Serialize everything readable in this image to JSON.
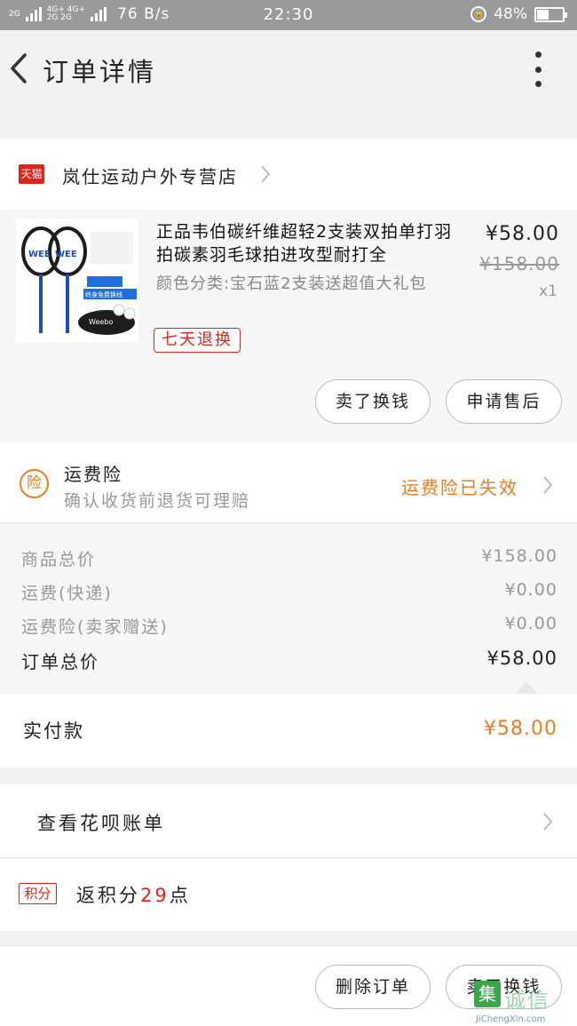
{
  "status_bar": {
    "network_left": "2G",
    "network_mid": "4G+ 4G+",
    "network_mid2": "2G 2G",
    "speed": "76 B/s",
    "time": "22:30",
    "battery": "48%",
    "battery_level": 0.48
  },
  "header": {
    "title": "订单详情"
  },
  "store": {
    "badge": "天猫",
    "name": "岚仕运动户外专营店"
  },
  "product": {
    "title": "正品韦伯碳纤维超轻2支装双拍单打羽拍碳素羽毛球拍进攻型耐打全",
    "spec": "颜色分类:宝石蓝2支装送超值大礼包",
    "badge": "七天退换",
    "price": "¥58.00",
    "original_price": "¥158.00",
    "quantity": "x1",
    "thumb_text": "终身免费换线",
    "thumb_brand": "Weebo",
    "btn_sell": "卖了换钱",
    "btn_after_sale": "申请售后"
  },
  "insurance": {
    "icon": "险",
    "title": "运费险",
    "subtitle": "确认收货前退货可理赔",
    "status": "运费险已失效"
  },
  "summary": {
    "rows": [
      {
        "label": "商品总价",
        "value": "¥158.00"
      },
      {
        "label": "运费(快递)",
        "value": "¥0.00"
      },
      {
        "label": "运费险(卖家赠送)",
        "value": "¥0.00"
      }
    ],
    "total_label": "订单总价",
    "total_value": "¥58.00"
  },
  "paid": {
    "label": "实付款",
    "value": "¥58.00"
  },
  "huabei": {
    "label": "查看花呗账单"
  },
  "points": {
    "tag": "积分",
    "prefix": "返积分",
    "count": "29",
    "suffix": "点"
  },
  "footer": {
    "btn_delete": "删除订单",
    "btn_sell": "卖了换钱"
  },
  "watermark": {
    "mark": "集",
    "brand": "诚信",
    "url": "JiChengXin.com"
  },
  "colors": {
    "accent_orange": "#f07b1e",
    "tmall_red": "#e2231a",
    "status_bar": "#9a9a9a"
  }
}
